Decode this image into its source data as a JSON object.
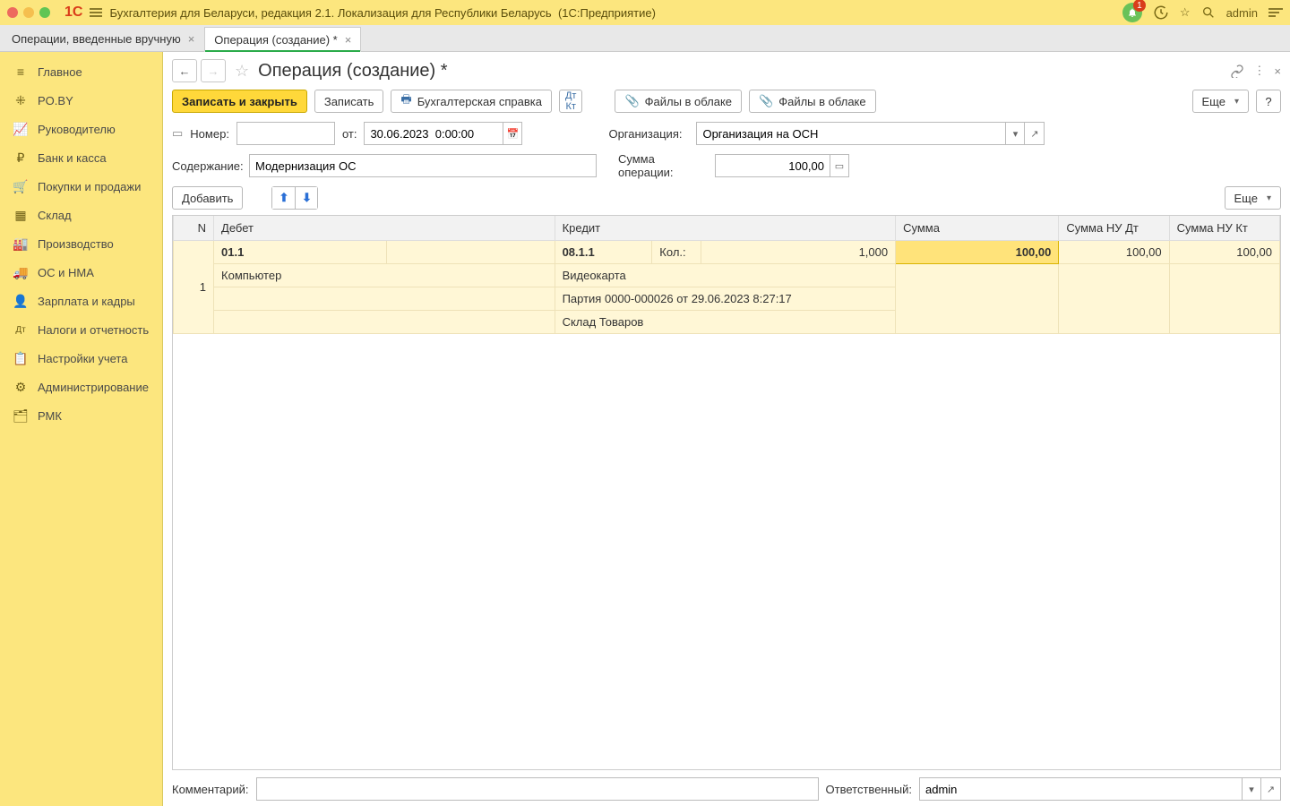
{
  "titlebar": {
    "app_name": "Бухгалтерия для Беларуси, редакция 2.1. Локализация для Республики Беларусь",
    "platform": "(1С:Предприятие)",
    "user": "admin",
    "notification_count": "1"
  },
  "tabs": [
    {
      "label": "Операции, введенные вручную"
    },
    {
      "label": "Операция (создание) *"
    }
  ],
  "sidebar": [
    {
      "icon": "≡",
      "label": "Главное"
    },
    {
      "icon": "⁜",
      "label": "PO.BY"
    },
    {
      "icon": "📈",
      "label": "Руководителю"
    },
    {
      "icon": "₽",
      "label": "Банк и касса"
    },
    {
      "icon": "🛒",
      "label": "Покупки и продажи"
    },
    {
      "icon": "▦",
      "label": "Склад"
    },
    {
      "icon": "🏭",
      "label": "Производство"
    },
    {
      "icon": "🚚",
      "label": "ОС и НМА"
    },
    {
      "icon": "👤",
      "label": "Зарплата и кадры"
    },
    {
      "icon": "Дт",
      "label": "Налоги и отчетность"
    },
    {
      "icon": "📋",
      "label": "Настройки учета"
    },
    {
      "icon": "⚙",
      "label": "Администрирование"
    },
    {
      "icon": "🗂",
      "label": "РМК"
    }
  ],
  "page": {
    "title": "Операция (создание) *"
  },
  "toolbar": {
    "save_close": "Записать и закрыть",
    "save": "Записать",
    "print_ref": "Бухгалтерская справка",
    "files1": "Файлы в облаке",
    "files2": "Файлы в облаке",
    "more": "Еще",
    "help": "?"
  },
  "form": {
    "number_label": "Номер:",
    "number_value": "",
    "from_label": "от:",
    "date_value": "30.06.2023  0:00:00",
    "org_label": "Организация:",
    "org_value": "Организация на ОСН",
    "content_label": "Содержание:",
    "content_value": "Модернизация ОС",
    "sum_label": "Сумма операции:",
    "sum_value": "100,00",
    "add_label": "Добавить"
  },
  "columns": {
    "n": "N",
    "debit": "Дебет",
    "credit": "Кредит",
    "sum": "Сумма",
    "sum_nu_dt": "Сумма НУ Дт",
    "sum_nu_kt": "Сумма НУ Кт"
  },
  "row1": {
    "n": "1",
    "debit_acct": "01.1",
    "debit_analytic1": "Компьютер",
    "credit_acct": "08.1.1",
    "credit_qty_label": "Кол.:",
    "credit_qty": "1,000",
    "credit_analytic1": "Видеокарта",
    "credit_analytic2": "Партия 0000-000026 от 29.06.2023 8:27:17",
    "credit_analytic3": "Склад Товаров",
    "sum": "100,00",
    "sum_nu_dt": "100,00",
    "sum_nu_kt": "100,00"
  },
  "footer": {
    "comment_label": "Комментарий:",
    "comment_value": "",
    "responsible_label": "Ответственный:",
    "responsible_value": "admin"
  }
}
